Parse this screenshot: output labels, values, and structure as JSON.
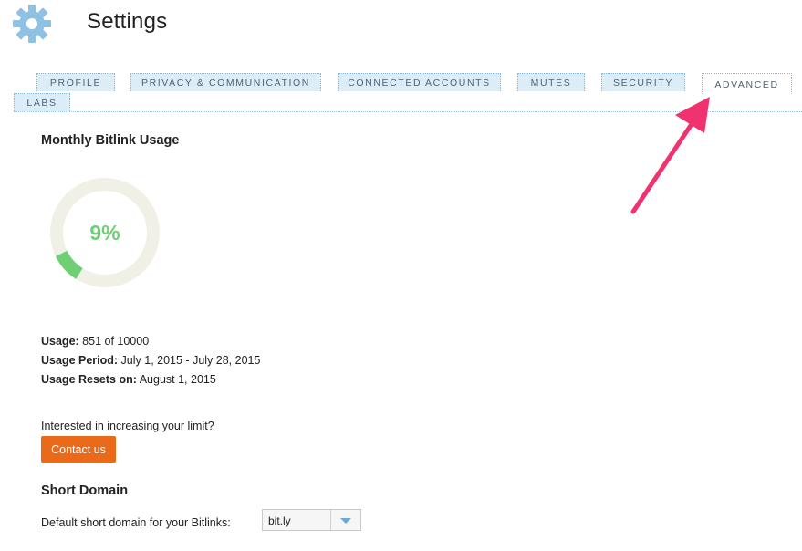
{
  "header": {
    "title": "Settings",
    "icon": "gear-icon",
    "icon_color": "#8fc1e3"
  },
  "tabs": [
    {
      "label": "PROFILE",
      "active": false
    },
    {
      "label": "PRIVACY & COMMUNICATION",
      "active": false
    },
    {
      "label": "CONNECTED ACCOUNTS",
      "active": false
    },
    {
      "label": "MUTES",
      "active": false
    },
    {
      "label": "SECURITY",
      "active": false
    },
    {
      "label": "ADVANCED",
      "active": true
    },
    {
      "label": "LABS",
      "active": false
    }
  ],
  "usage": {
    "section_title": "Monthly Bitlink Usage",
    "percent_label": "9%",
    "percent_value": 9,
    "used_color": "#6fcf74",
    "track_color": "#f0f0e6",
    "usage_label": "Usage:",
    "usage_value": "851 of 10000",
    "period_label": "Usage Period:",
    "period_value": "July 1, 2015 - July 28, 2015",
    "resets_label": "Usage Resets on:",
    "resets_value": "August 1, 2015"
  },
  "limit": {
    "prompt": "Interested in increasing your limit?",
    "contact_label": "Contact us",
    "button_color": "#ea6a1a"
  },
  "short_domain": {
    "section_title": "Short Domain",
    "field_label": "Default short domain for your Bitlinks:",
    "selected_value": "bit.ly"
  },
  "annotation": {
    "arrow_color": "#f0336e"
  }
}
